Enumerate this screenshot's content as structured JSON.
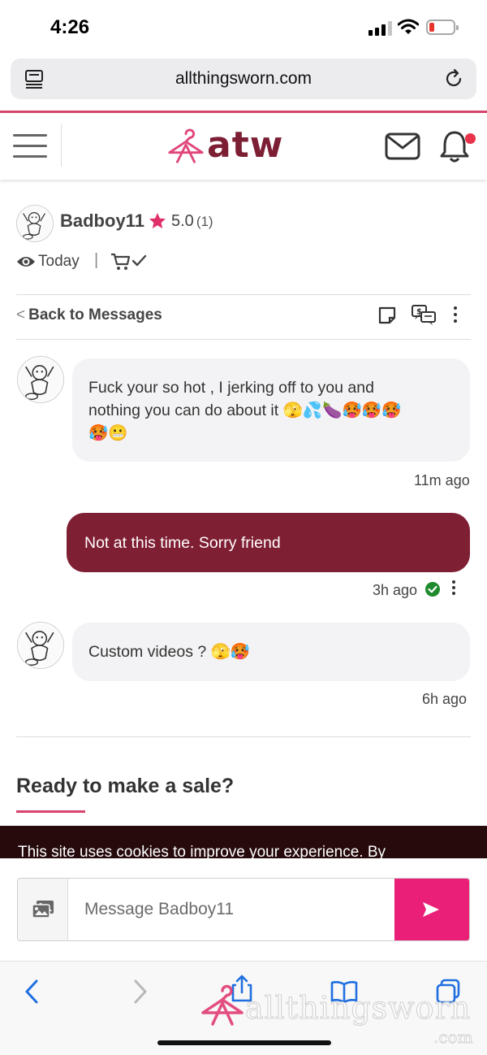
{
  "status_bar": {
    "time": "4:26",
    "battery_level": 0.15,
    "signal_bars": 3
  },
  "browser": {
    "url": "allthingsworn.com"
  },
  "header": {
    "logo_text": "atw",
    "brand_color": "#7d1f34",
    "accent_color": "#d8436e",
    "notification_dot": true
  },
  "conversation": {
    "username": "Badboy11",
    "rating": "5.0",
    "rating_count": "(1)",
    "last_seen": "Today",
    "separator": "|",
    "back_label": "Back to Messages"
  },
  "messages": [
    {
      "direction": "incoming",
      "lines": [
        "Fuck your so hot , I jerking off to you and",
        "nothing you can do about it 🫣💦🍆🥵🥵🥵",
        "🥵😬"
      ],
      "time": "11m ago"
    },
    {
      "direction": "outgoing",
      "text": "Not at this time. Sorry friend",
      "time": "3h ago",
      "read": true
    },
    {
      "direction": "incoming",
      "lines": [
        "Custom videos ? 🫣🥵"
      ],
      "time": "6h ago"
    }
  ],
  "sale": {
    "title": "Ready to make a sale?"
  },
  "cookie_notice": {
    "text": "This site uses cookies to improve your experience. By"
  },
  "compose": {
    "placeholder": "Message Badboy11",
    "send_color": "#ea1f77"
  },
  "watermark": {
    "text": "allthingsworn",
    "suffix": ".com"
  },
  "icons": [
    "reader-icon",
    "reload-icon",
    "hamburger-icon",
    "logo-hanger-icon",
    "mail-icon",
    "bell-icon",
    "star-icon",
    "eye-icon",
    "cart-check-icon",
    "note-icon",
    "offer-icon",
    "kebab-icon",
    "check-circle-icon",
    "image-icon",
    "send-icon",
    "back-icon",
    "forward-icon",
    "share-icon",
    "bookmarks-icon",
    "tabs-icon"
  ]
}
